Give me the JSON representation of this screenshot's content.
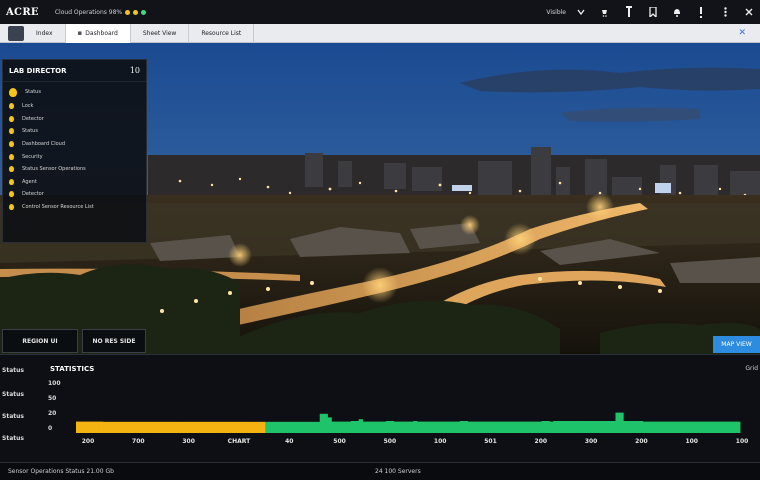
{
  "app": {
    "brand": "ACRE",
    "status_text": "Cloud Operations 98%",
    "status_colors": [
      "#f5c518",
      "#f5c518",
      "#3ddc84"
    ]
  },
  "topbar_right": {
    "label": "Visible",
    "icons": [
      "chevron-down-icon",
      "cart-icon",
      "pin-icon",
      "bookmark-icon",
      "bell-icon",
      "alert-icon",
      "more-icon",
      "close-icon"
    ]
  },
  "tabs": [
    {
      "label": "Index"
    },
    {
      "label": "Dashboard",
      "active": true
    },
    {
      "label": "Sheet View"
    },
    {
      "label": "Resource List"
    }
  ],
  "sidepanel": {
    "title": "LAB DIRECTOR",
    "count": "10",
    "items": [
      "Status",
      "Lock",
      "Detector",
      "Status",
      "Dashboard Cloud",
      "Security",
      "Status Sensor Operations",
      "Agent",
      "Detector",
      "Control Sensor Resource List"
    ]
  },
  "mid_buttons": {
    "left": "REGION UI",
    "right": "NO RES SIDE"
  },
  "live_chip": "MAP VIEW",
  "bottom": {
    "title": "STATISTICS",
    "right_label": "Grid",
    "left_labels": [
      "Status",
      "Status",
      "Status",
      "Status"
    ]
  },
  "chart_data": {
    "type": "bar",
    "title": "STATISTICS",
    "xlabel": "",
    "ylabel": "",
    "y_tick_labels": [
      "100",
      "50",
      "20",
      "0"
    ],
    "x_tick_labels": [
      "200",
      "700",
      "300",
      "CHART",
      "40",
      "500",
      "500",
      "100",
      "501",
      "200",
      "300",
      "200",
      "100",
      "100"
    ],
    "series": [
      {
        "color": "#f5b312",
        "values": [
          0.95,
          0.95,
          0.95,
          0.95,
          0.95,
          0.95,
          0.93,
          0.93,
          0.93,
          0.93,
          0.93,
          0.93,
          0.93,
          0.93,
          0.93,
          0.93,
          0.93,
          0.93,
          0.93,
          0.93,
          0.93,
          0.93,
          0.93,
          0.93,
          0.93,
          0.93,
          0.93,
          0.93,
          0.93,
          0.93,
          0.93,
          0.93,
          0.93,
          0.93,
          0.93,
          0.93,
          0.93,
          0.93,
          0.93,
          0.93,
          0.93,
          0.93
        ]
      },
      {
        "color": "#1fc46a",
        "values": [
          0.93,
          0.93,
          0.93,
          0.93,
          0.93,
          0.93,
          0.93,
          0.93,
          0.93,
          0.93,
          0.93,
          0.93,
          0.93,
          0.93,
          1.6,
          1.6,
          1.3,
          0.95,
          0.95,
          0.95,
          0.95,
          0.95,
          1.0,
          1.0,
          1.15,
          0.95,
          0.95,
          0.95,
          0.95,
          0.95,
          0.95,
          1.0,
          1.0,
          0.95,
          0.95,
          0.95,
          0.95,
          0.95,
          1.0,
          0.95,
          0.95,
          0.95,
          0.95,
          0.95,
          0.95,
          0.95,
          0.95,
          0.95,
          0.95,
          0.95,
          1.0,
          1.0,
          0.95,
          0.95,
          0.95,
          0.95,
          0.95,
          0.95,
          0.95,
          0.95,
          0.95,
          0.95,
          0.95,
          0.95,
          0.95,
          0.95,
          0.95,
          0.95,
          0.95,
          0.95,
          0.95,
          1.0,
          1.0,
          0.95,
          1.0,
          1.0,
          1.0,
          1.0,
          1.0,
          1.0,
          1.0,
          1.0,
          1.0,
          1.0,
          1.0,
          1.0,
          1.0,
          1.0,
          1.0,
          1.0,
          1.7,
          1.7,
          1.0,
          1.0,
          1.0,
          1.0,
          1.0,
          0.95,
          0.95,
          0.95,
          0.95,
          0.95,
          0.95,
          0.95,
          0.95,
          0.95,
          0.95,
          0.95,
          0.95,
          0.95,
          0.95,
          0.95,
          0.95,
          0.95,
          0.95,
          0.95,
          0.95,
          0.95,
          0.95,
          0.95,
          0.95,
          0.95
        ]
      }
    ],
    "ylim": [
      0,
      2
    ],
    "grid": false
  },
  "footer": {
    "left": "Sensor Operations Status 21.00 Gb",
    "mid": "24 100 Servers"
  }
}
